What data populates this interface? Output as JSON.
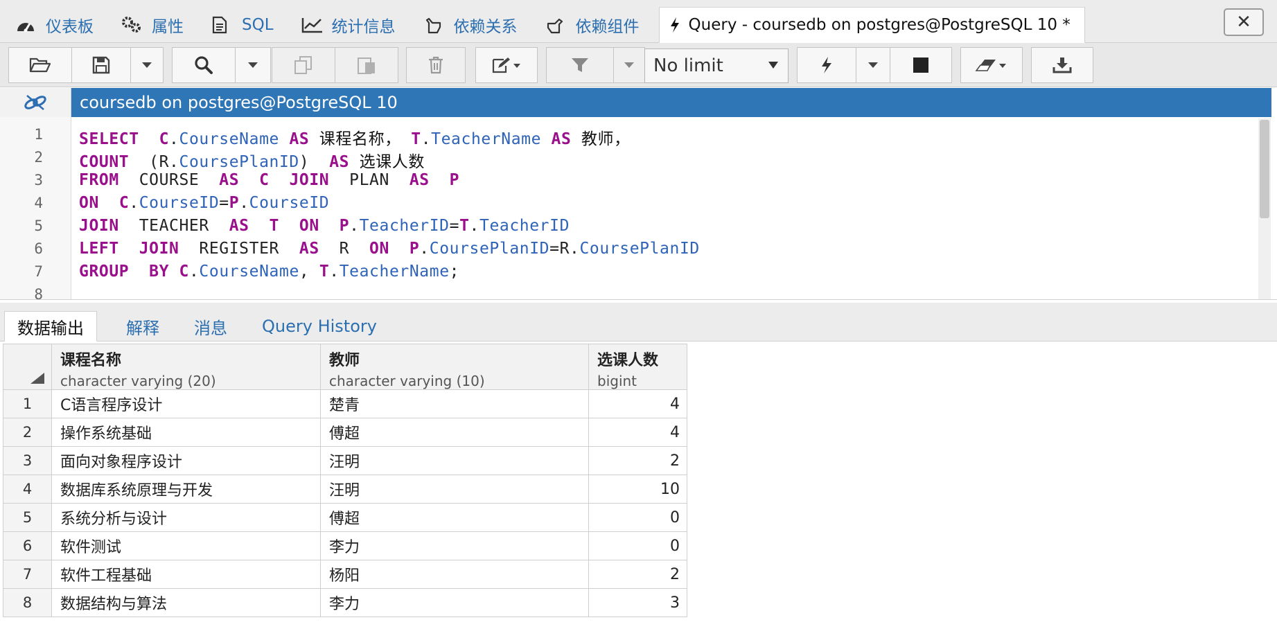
{
  "tabs": [
    {
      "label": "仪表板",
      "icon": "dashboard-icon"
    },
    {
      "label": "属性",
      "icon": "properties-icon"
    },
    {
      "label": "SQL",
      "icon": "sql-icon"
    },
    {
      "label": "统计信息",
      "icon": "statistics-icon"
    },
    {
      "label": "依赖关系",
      "icon": "dependencies-icon"
    },
    {
      "label": "依赖组件",
      "icon": "dependents-icon"
    }
  ],
  "active_tab": {
    "label": "Query - coursedb on postgres@PostgreSQL 10 *",
    "icon": "lightning-icon"
  },
  "close_label": "✕",
  "toolbar": {
    "limit_value": "No limit"
  },
  "connection": {
    "label": "coursedb on postgres@PostgreSQL 10"
  },
  "editor": {
    "line_numbers": [
      "1",
      "2",
      "3",
      "4",
      "5",
      "6",
      "7",
      "8"
    ]
  },
  "result_tabs": [
    "数据输出",
    "解释",
    "消息",
    "Query History"
  ],
  "grid": {
    "columns": [
      {
        "name": "课程名称",
        "type": "character varying (20)"
      },
      {
        "name": "教师",
        "type": "character varying (10)"
      },
      {
        "name": "选课人数",
        "type": "bigint"
      }
    ],
    "rows": [
      {
        "n": "1",
        "course": "C语言程序设计",
        "teacher": "楚青",
        "count": "4"
      },
      {
        "n": "2",
        "course": "操作系统基础",
        "teacher": "傅超",
        "count": "4"
      },
      {
        "n": "3",
        "course": "面向对象程序设计",
        "teacher": "汪明",
        "count": "2"
      },
      {
        "n": "4",
        "course": "数据库系统原理与开发",
        "teacher": "汪明",
        "count": "10"
      },
      {
        "n": "5",
        "course": "系统分析与设计",
        "teacher": "傅超",
        "count": "0"
      },
      {
        "n": "6",
        "course": "软件测试",
        "teacher": "李力",
        "count": "0"
      },
      {
        "n": "7",
        "course": "软件工程基础",
        "teacher": "杨阳",
        "count": "2"
      },
      {
        "n": "8",
        "course": "数据结构与算法",
        "teacher": "李力",
        "count": "3"
      }
    ]
  }
}
